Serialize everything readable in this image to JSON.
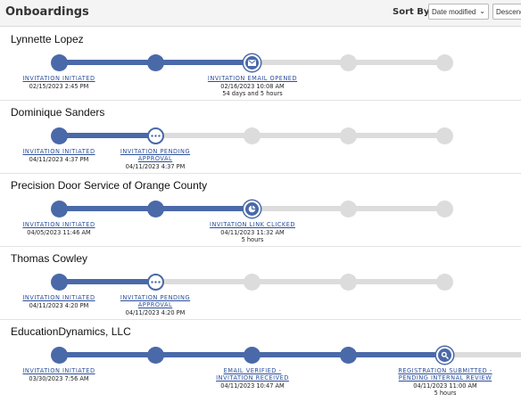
{
  "header": {
    "title": "Onboardings",
    "sort_label": "Sort By:",
    "sort_value": "Date modified",
    "sort_order": "Descending"
  },
  "colors": {
    "accent": "#4a69a8",
    "track": "#dcdcdc"
  },
  "onboardings": [
    {
      "name": "Lynnette Lopez",
      "progress_steps": 3,
      "total_steps": 5,
      "current_icon": "envelope-icon",
      "steps": [
        {
          "label": "INVITATION INITIATED",
          "date": "02/15/2023 2:45 PM"
        },
        {
          "label": "",
          "date": ""
        },
        {
          "label": "INVITATION EMAIL OPENED",
          "date": "02/16/2023 10:08 AM",
          "duration": "54 days and 5 hours"
        }
      ]
    },
    {
      "name": "Dominique Sanders",
      "progress_steps": 2,
      "total_steps": 5,
      "current_icon": "ellipsis-icon",
      "steps": [
        {
          "label": "INVITATION INITIATED",
          "date": "04/11/2023 4:37 PM"
        },
        {
          "label_line1": "INVITATION PENDING",
          "label_line2": "APPROVAL",
          "date": "04/11/2023 4:37 PM"
        }
      ]
    },
    {
      "name": "Precision Door Service of Orange County",
      "progress_steps": 3,
      "total_steps": 5,
      "current_icon": "pie-icon",
      "steps": [
        {
          "label": "INVITATION INITIATED",
          "date": "04/05/2023 11:46 AM"
        },
        {
          "label": "",
          "date": ""
        },
        {
          "label": "INVITATION LINK CLICKED",
          "date": "04/11/2023 11:32 AM",
          "duration": "5 hours"
        }
      ]
    },
    {
      "name": "Thomas Cowley",
      "progress_steps": 2,
      "total_steps": 5,
      "current_icon": "ellipsis-icon",
      "steps": [
        {
          "label": "INVITATION INITIATED",
          "date": "04/11/2023 4:20 PM"
        },
        {
          "label_line1": "INVITATION PENDING",
          "label_line2": "APPROVAL",
          "date": "04/11/2023 4:20 PM"
        }
      ]
    },
    {
      "name": "EducationDynamics, LLC",
      "progress_steps": 5,
      "total_steps": 5,
      "current_icon": "search-icon",
      "steps": [
        {
          "label": "INVITATION INITIATED",
          "date": "03/30/2023 7:56 AM"
        },
        {
          "label": "",
          "date": ""
        },
        {
          "label_line1": "EMAIL VERIFIED -",
          "label_line2": "INVITATION RECEIVED",
          "date": "04/11/2023 10:47 AM"
        },
        {
          "label": "",
          "date": ""
        },
        {
          "label_line1": "REGISTRATION SUBMITTED -",
          "label_line2": "PENDING INTERNAL REVIEW",
          "date": "04/11/2023 11:00 AM",
          "duration": "5 hours"
        }
      ]
    }
  ]
}
